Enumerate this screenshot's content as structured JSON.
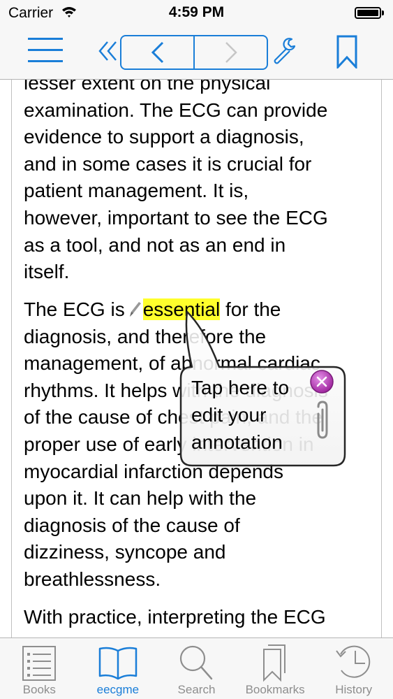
{
  "status_bar": {
    "carrier": "Carrier",
    "time": "4:59 PM"
  },
  "toolbar": {
    "menu_icon": "hamburger-icon",
    "first_icon": "double-chevron-left-icon",
    "prev_icon": "chevron-left-icon",
    "next_icon": "chevron-right-icon",
    "settings_icon": "wrench-icon",
    "bookmark_icon": "bookmark-icon"
  },
  "content": {
    "paragraphs": [
      {
        "lines": [
          "lesser extent on the physical",
          "examination. The ECG can provide",
          "evidence to support a diagnosis,",
          "and in some cases it is crucial for",
          "patient management. It is,",
          "however, important to see the ECG",
          "as a tool, and not as an end in",
          "itself."
        ]
      },
      {
        "first_line_pre": "The ECG is",
        "highlighted_word": "essential",
        "first_line_post": "for the",
        "lines": [
          "diagnosis, and therefore the",
          "management, of abnormal cardiac",
          "rhythms. It helps with the diagnosis",
          "of the cause of chest pain, and the",
          "proper use of early intervention in",
          "myocardial infarction depends",
          "upon it. It can help with the",
          "diagnosis of the cause of",
          "dizziness, syncope and",
          "breathlessness."
        ]
      },
      {
        "lines": [
          "With practice, interpreting the ECG"
        ]
      }
    ]
  },
  "annotation_popup": {
    "text_lines": [
      "Tap here to",
      "edit your",
      "annotation"
    ],
    "close_icon": "close-icon",
    "attachment_icon": "paperclip-icon"
  },
  "tabbar": {
    "tabs": [
      {
        "label": "Books",
        "icon": "books-list-icon",
        "active": false
      },
      {
        "label": "eecgme",
        "icon": "open-book-icon",
        "active": true
      },
      {
        "label": "Search",
        "icon": "search-icon",
        "active": false
      },
      {
        "label": "Bookmarks",
        "icon": "bookmarks-icon",
        "active": false
      },
      {
        "label": "History",
        "icon": "history-clock-icon",
        "active": false
      }
    ]
  },
  "colors": {
    "accent": "#1a7ed8",
    "highlight": "#ffff2c",
    "bar_bg": "#f7f7f7",
    "inactive": "#8e8e8e"
  }
}
